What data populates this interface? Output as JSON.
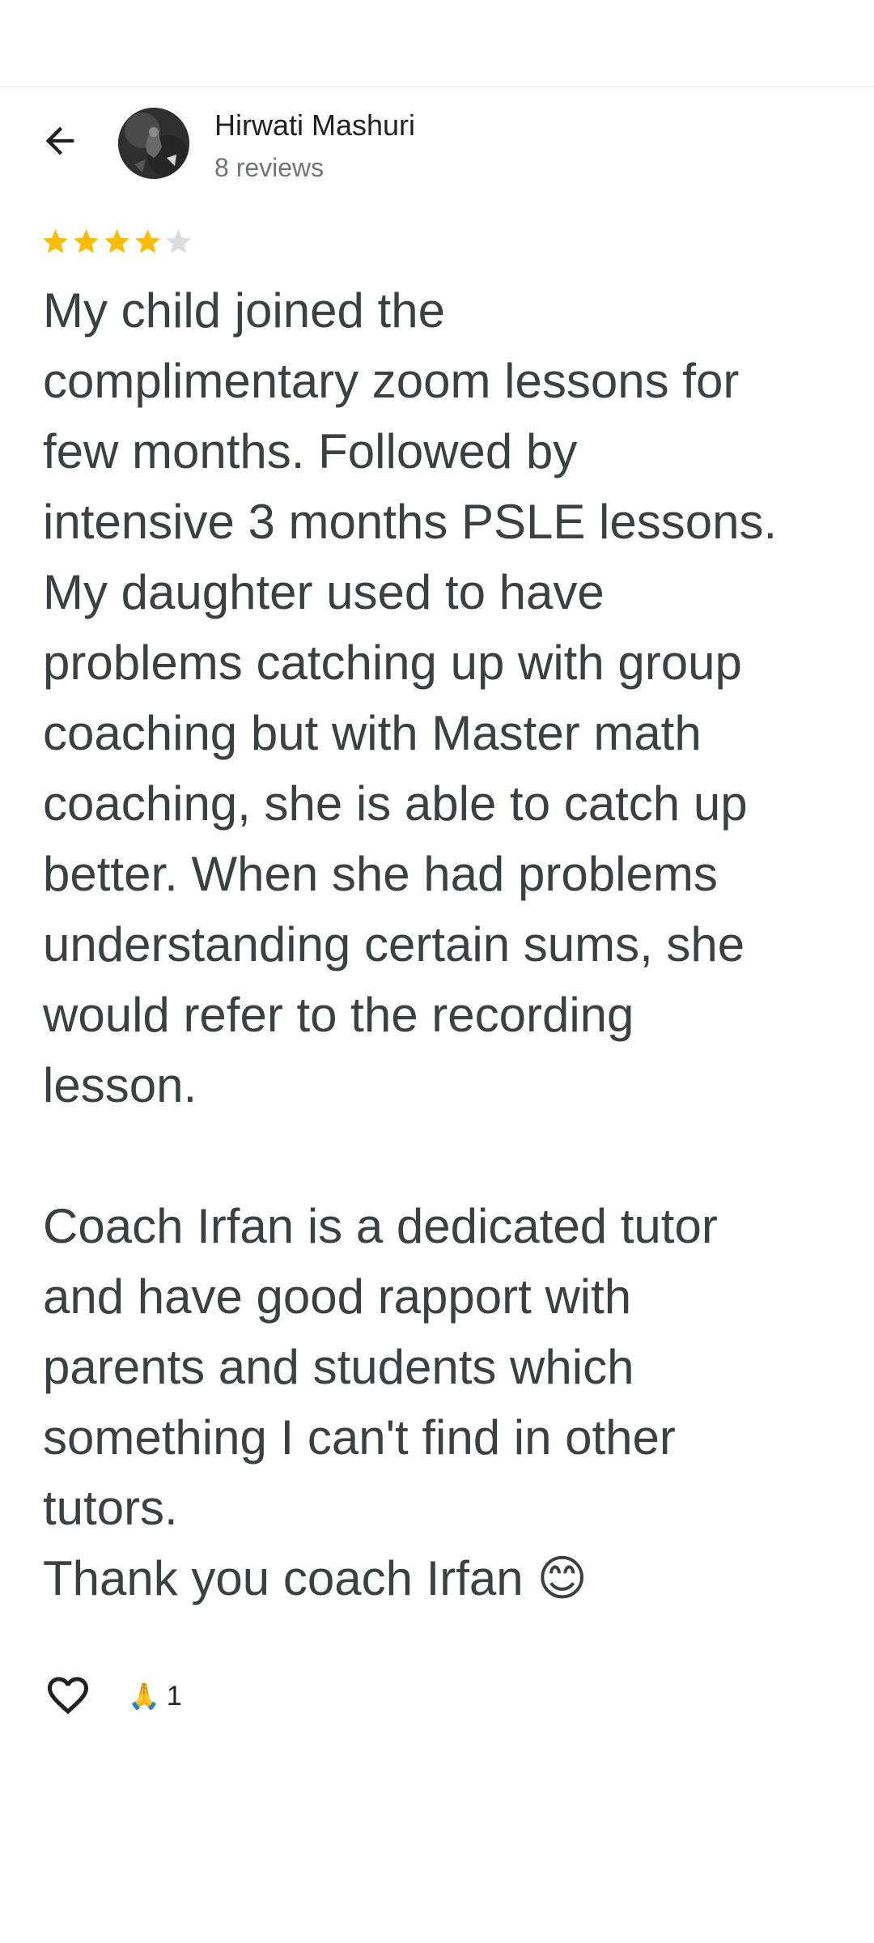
{
  "header": {
    "back_icon": "arrow-left-icon",
    "reviewer": {
      "name": "Hirwati Mashuri",
      "review_count": "8 reviews",
      "avatar": "profile-photo"
    }
  },
  "review": {
    "rating": 4,
    "rating_max": 5,
    "star_color_filled": "#fbbc04",
    "star_color_empty": "#dadce0",
    "text": "My child joined the\ncomplimentary zoom lessons for\nfew months. Followed by\nintensive 3 months PSLE lessons.\nMy daughter used to have\nproblems catching up with group\ncoaching but with Master math\ncoaching, she is able to catch up\nbetter. When she had problems\nunderstanding certain sums, she\nwould refer to the recording\nlesson.\n\nCoach Irfan is a dedicated tutor\nand have good rapport with\nparents and students which\nsomething I can't find in other\ntutors.\nThank you coach Irfan 😊"
  },
  "actions": {
    "like_icon": "heart-outline-icon",
    "reaction_emoji": "🙏",
    "reaction_count": "1"
  }
}
